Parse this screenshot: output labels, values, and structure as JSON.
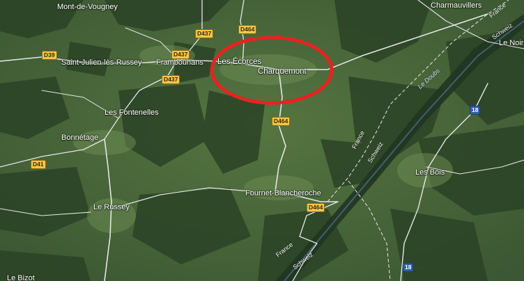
{
  "map": {
    "colors": {
      "forest": "#2f4a28",
      "field": "#5c7a45",
      "road": "#e6e6e6",
      "highlight": "#e52421"
    },
    "places": {
      "mont_de_vougney": "Mont-de-Vougney",
      "charmauvillers": "Charmauvillers",
      "saint_julien": "Saint-Julien-lès-Russey",
      "frambouhans": "Frambouhans",
      "les_ecorces": "Les Écorces",
      "charquemont": "Charquemont",
      "les_fontenelles": "Les Fontenelles",
      "bonnetage": "Bonnétage",
      "fournet": "Fournet-Blancheroche",
      "le_russey": "Le Russey",
      "les_bois": "Les Bois",
      "le_noirmont": "Le Noir",
      "le_bizot": "Le Bizot"
    },
    "roads": {
      "d464_top": "D464",
      "d437_a": "D437",
      "d437_b": "D437",
      "d437_c": "D437",
      "d39": "D39",
      "d41": "D41",
      "d464_mid": "D464",
      "d464_low": "D464",
      "route18_a": "18",
      "route18_b": "18"
    },
    "borders": {
      "france_1": "France",
      "schweiz_1": "Schweiz",
      "france_2": "France",
      "schweiz_2": "Schweiz",
      "schweiz_3": "Schweiz"
    },
    "river": "Le Doubs"
  }
}
